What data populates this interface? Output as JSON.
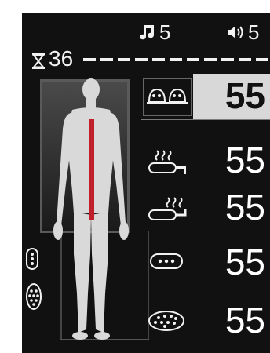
{
  "status": {
    "music_icon": "music-note-icon",
    "music_value": "5",
    "volume_icon": "speaker-icon",
    "volume_value": "5"
  },
  "timer": {
    "icon": "hourglass-icon",
    "value": "36"
  },
  "levels": [
    {
      "icon": "pillow-massage-icon",
      "value": "55",
      "selected": true
    },
    {
      "icon": "heat-lumbar-icon",
      "value": "55",
      "selected": false
    },
    {
      "icon": "heat-seat-icon",
      "value": "55",
      "selected": false
    },
    {
      "icon": "roller-icon",
      "value": "55",
      "selected": false
    },
    {
      "icon": "airbag-icon",
      "value": "55",
      "selected": false
    }
  ],
  "colors": {
    "background": "#111111",
    "text": "#ffffff",
    "selected_bg": "#d8d8d8",
    "spine_highlight": "#c21f2c",
    "figure": "#d9d9d9"
  }
}
